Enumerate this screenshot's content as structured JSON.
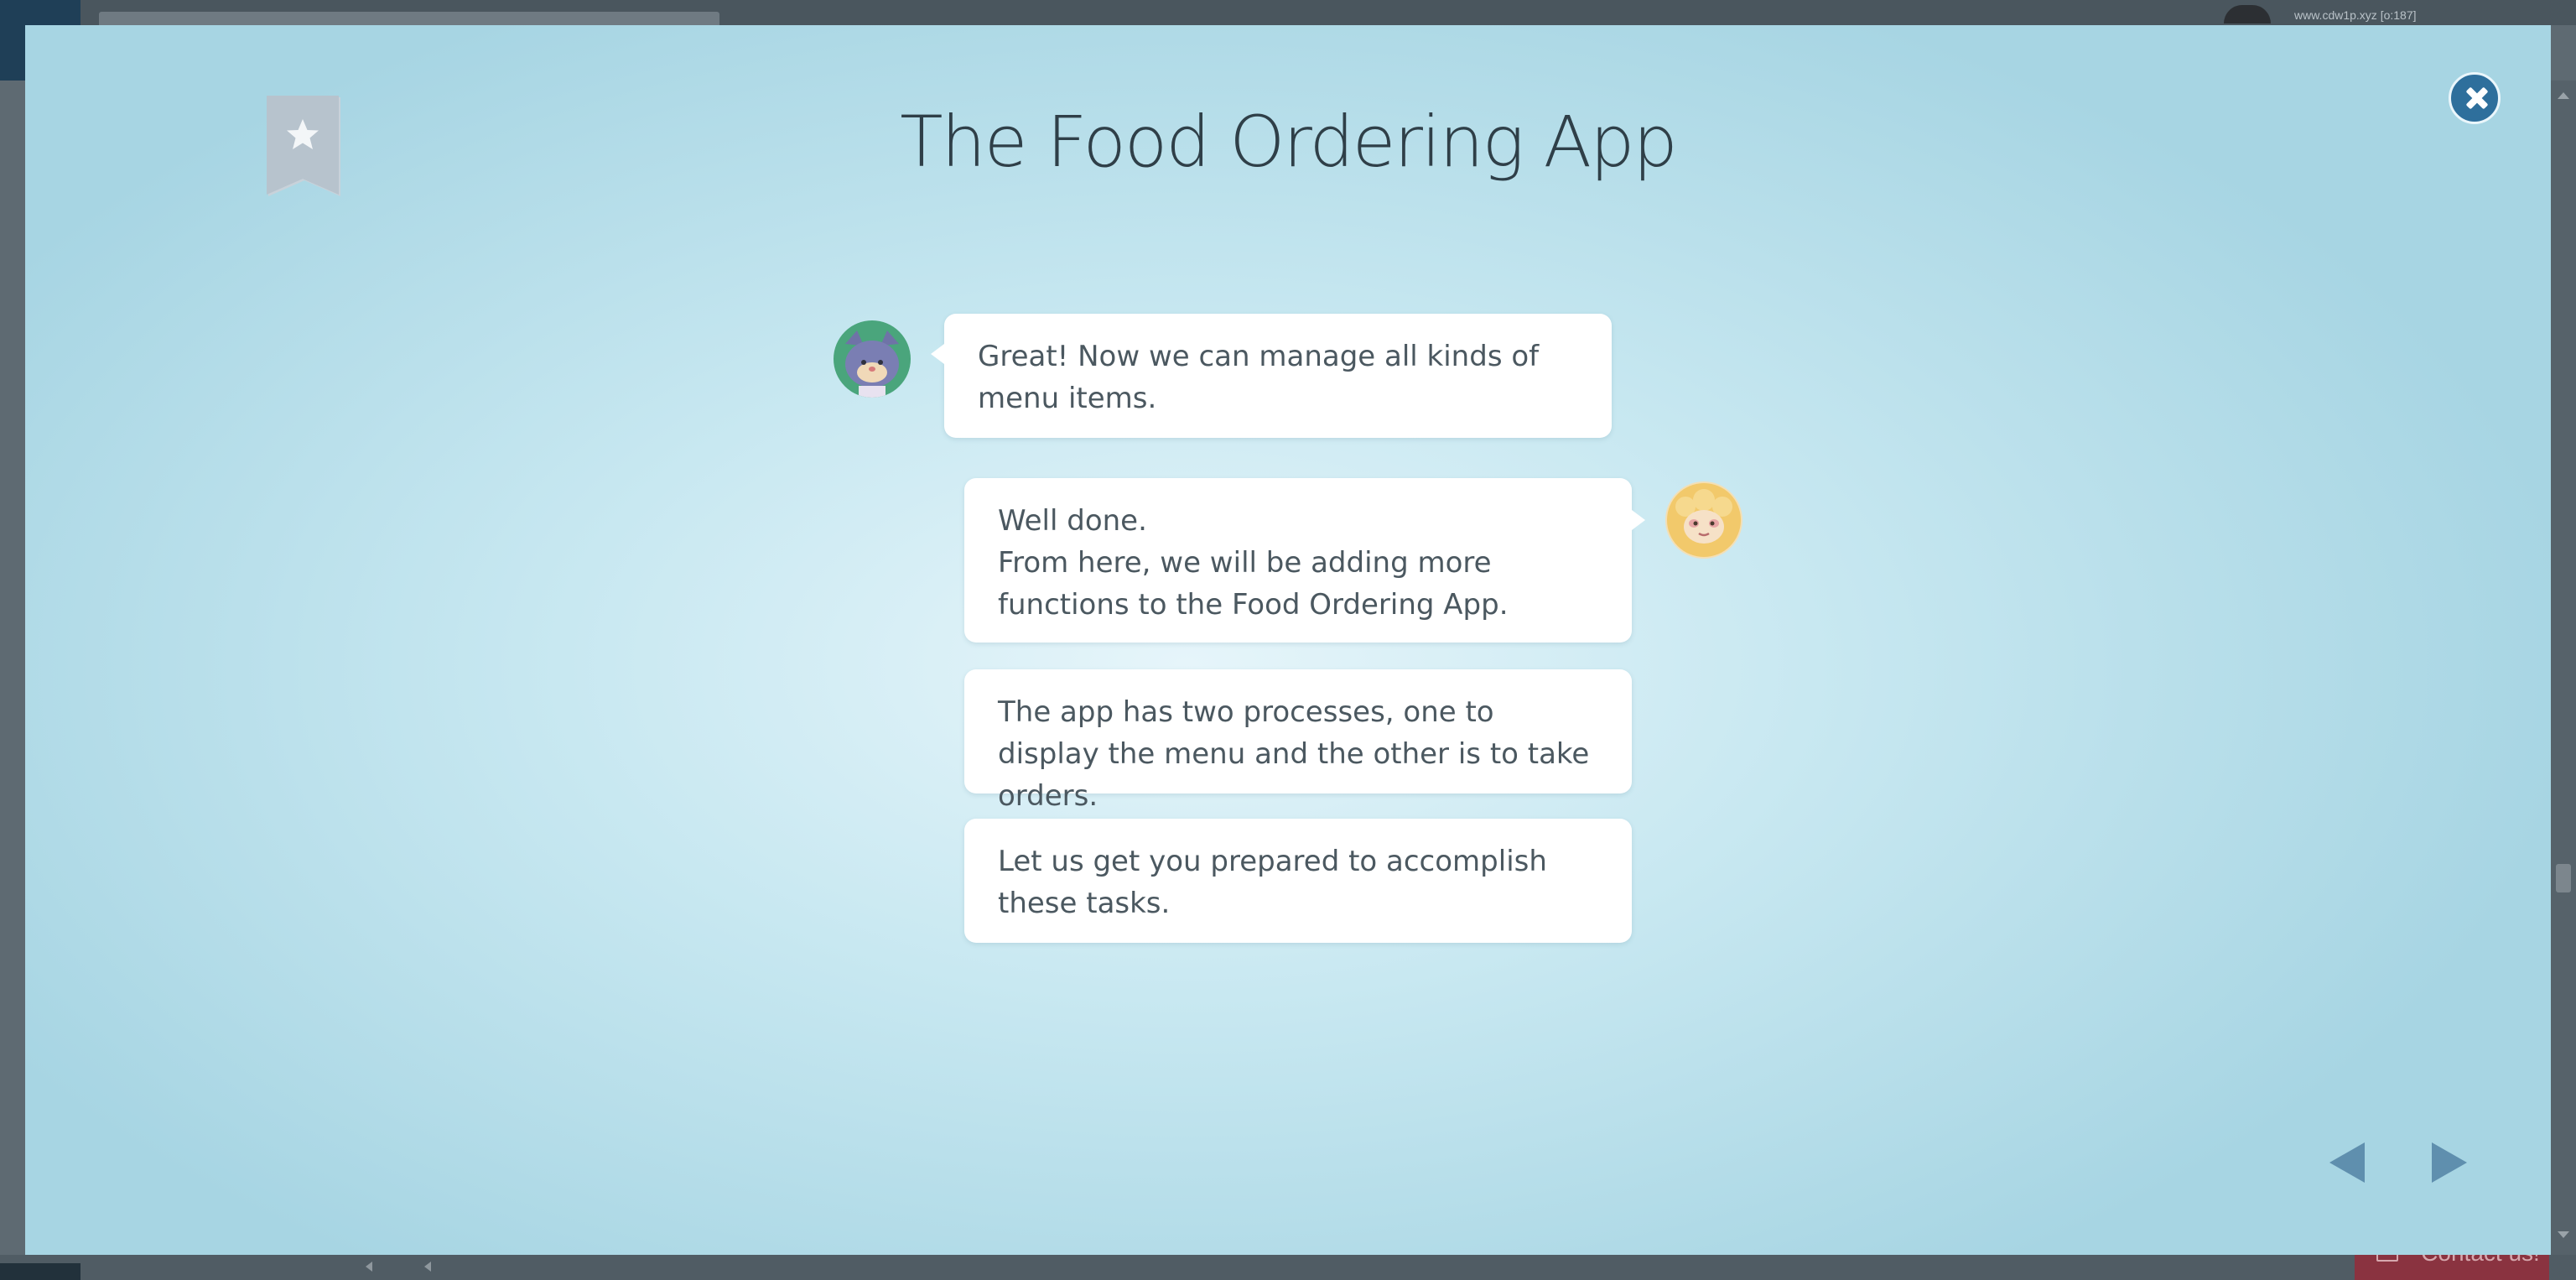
{
  "background_app": {
    "user_label": "www.cdw1p.xyz [o:187]",
    "contact_label": "Contact us!"
  },
  "dialog": {
    "title": "The Food Ordering App",
    "messages": [
      {
        "speaker": "cat",
        "lines": [
          "Great! Now we can manage all kinds of menu items."
        ]
      },
      {
        "speaker": "sheep",
        "lines": [
          "Well done.",
          "From here, we will be adding more functions to the Food Ordering App."
        ]
      },
      {
        "speaker": "sheep",
        "lines": [
          "The app has two processes, one to display the menu and the other is to take orders."
        ]
      },
      {
        "speaker": "sheep",
        "lines": [
          "Let us get you prepared to accomplish these tasks."
        ]
      }
    ]
  },
  "icons": {
    "bookmark": "bookmark-star-icon",
    "close": "close-icon",
    "prev": "triangle-left-icon",
    "next": "triangle-right-icon"
  },
  "colors": {
    "modal_bg": "#c8e8f1",
    "close_button": "#2e6f9c",
    "nav_arrow": "#5f8fae",
    "contact_button": "#8a3340",
    "text": "#4b5860",
    "title": "#2f3f48"
  }
}
